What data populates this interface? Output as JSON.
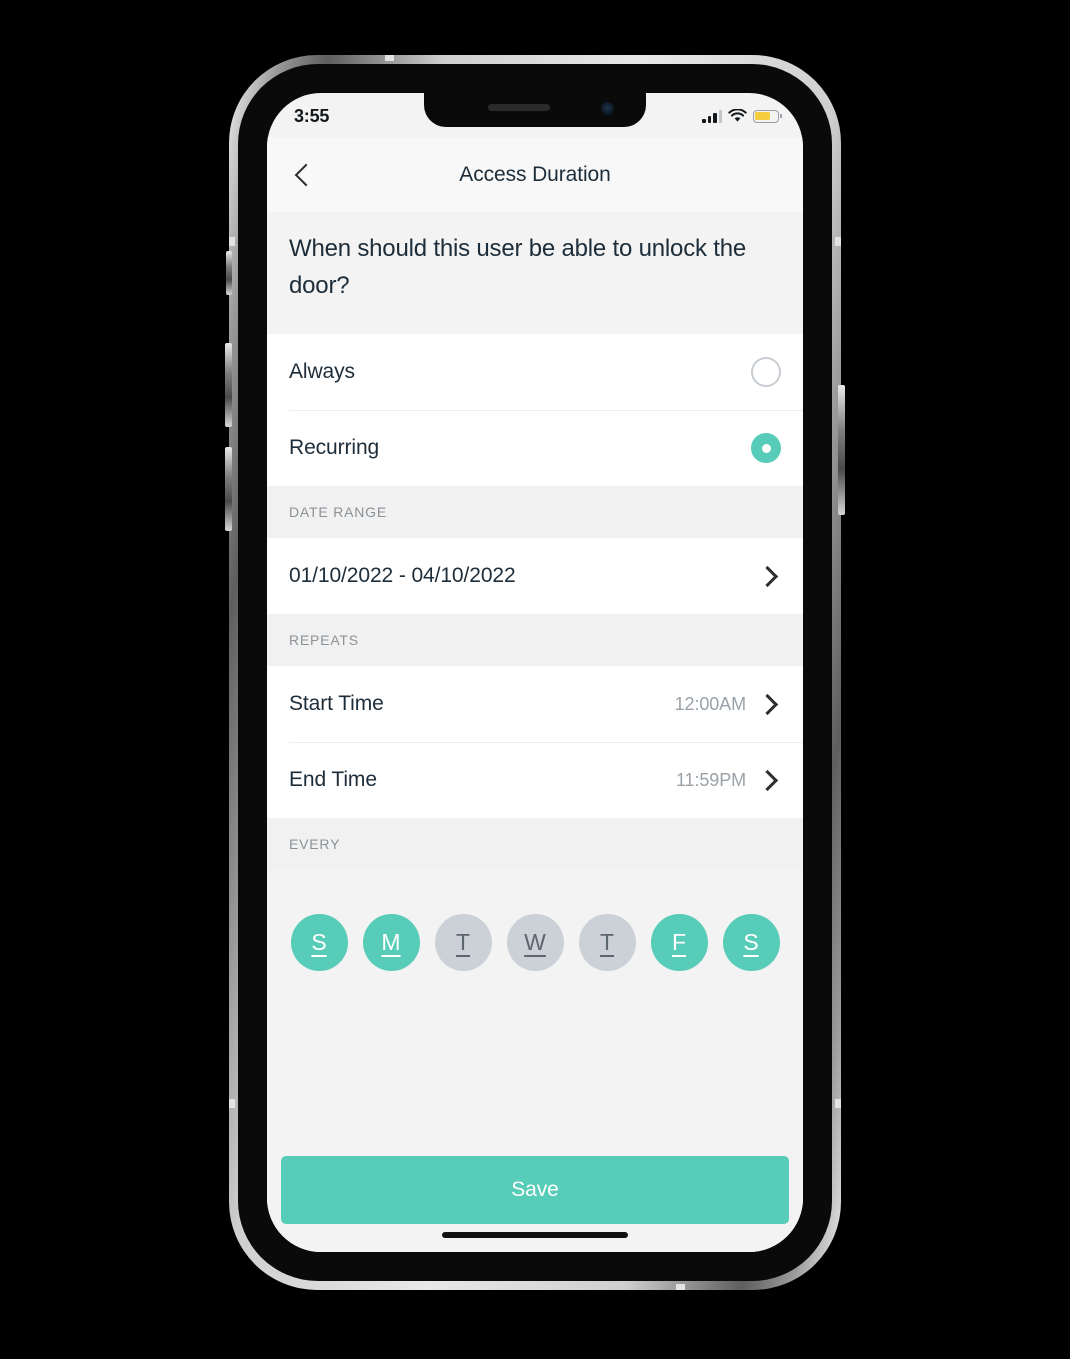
{
  "status_bar": {
    "time": "3:55",
    "signal_icon": "cellular-signal-icon",
    "wifi_icon": "wifi-icon",
    "battery_icon": "battery-icon",
    "battery_level_percent": 70,
    "battery_color": "#f6cd3c"
  },
  "nav": {
    "back_icon": "chevron-left-icon",
    "title": "Access Duration"
  },
  "question": "When should this user be able to unlock the door?",
  "access_options": [
    {
      "label": "Always",
      "selected": false
    },
    {
      "label": "Recurring",
      "selected": true
    }
  ],
  "date_range": {
    "section_title": "DATE RANGE",
    "value": "01/10/2022 - 04/10/2022",
    "chevron_icon": "chevron-right-icon"
  },
  "repeats": {
    "section_title": "REPEATS",
    "rows": [
      {
        "label": "Start Time",
        "value": "12:00AM",
        "chevron_icon": "chevron-right-icon"
      },
      {
        "label": "End Time",
        "value": "11:59PM",
        "chevron_icon": "chevron-right-icon"
      }
    ]
  },
  "every": {
    "section_title": "EVERY",
    "days": [
      {
        "letter": "S",
        "name": "sunday",
        "selected": true
      },
      {
        "letter": "M",
        "name": "monday",
        "selected": true
      },
      {
        "letter": "T",
        "name": "tuesday",
        "selected": false
      },
      {
        "letter": "W",
        "name": "wednesday",
        "selected": false
      },
      {
        "letter": "T",
        "name": "thursday",
        "selected": false
      },
      {
        "letter": "F",
        "name": "friday",
        "selected": true
      },
      {
        "letter": "S",
        "name": "saturday",
        "selected": true
      }
    ]
  },
  "footer": {
    "save_label": "Save"
  },
  "colors": {
    "accent_teal": "#57ccb8",
    "text_dark": "#1d2d3a",
    "text_muted": "#8b9298",
    "screen_bg": "#f2f3f2",
    "card_bg": "#ffffff",
    "day_inactive": "#cbd1d7"
  }
}
